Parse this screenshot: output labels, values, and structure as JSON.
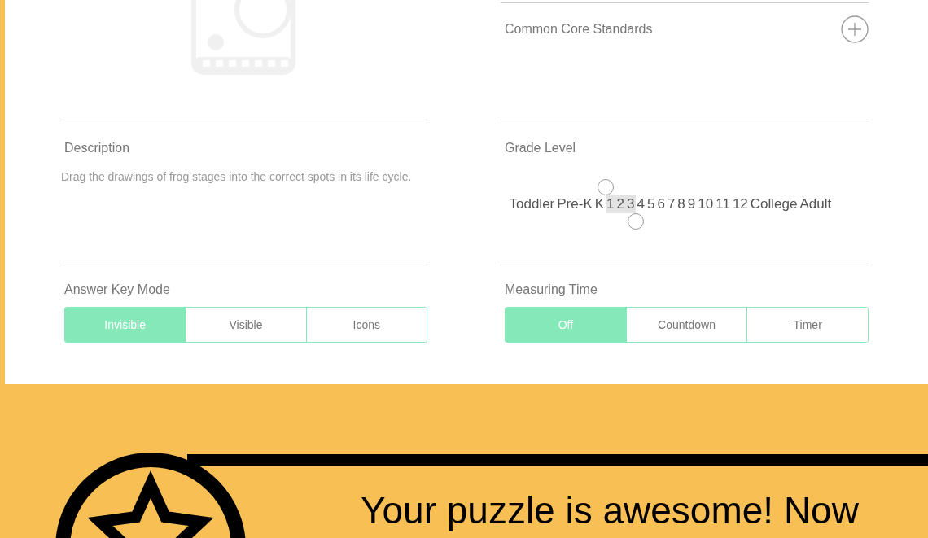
{
  "common_core_standards": {
    "label": "Common Core Standards"
  },
  "description": {
    "label": "Description",
    "text": "Drag the drawings of frog stages into the correct spots in its life cycle."
  },
  "grade_level": {
    "label": "Grade Level",
    "grades": [
      {
        "label": "Toddler",
        "selected": false
      },
      {
        "label": "Pre-K",
        "selected": false
      },
      {
        "label": "K",
        "selected": false
      },
      {
        "label": "1",
        "selected": true
      },
      {
        "label": "2",
        "selected": true
      },
      {
        "label": "3",
        "selected": true
      },
      {
        "label": "4",
        "selected": false
      },
      {
        "label": "5",
        "selected": false
      },
      {
        "label": "6",
        "selected": false
      },
      {
        "label": "7",
        "selected": false
      },
      {
        "label": "8",
        "selected": false
      },
      {
        "label": "9",
        "selected": false
      },
      {
        "label": "10",
        "selected": false
      },
      {
        "label": "11",
        "selected": false
      },
      {
        "label": "12",
        "selected": false
      },
      {
        "label": "College",
        "selected": false
      },
      {
        "label": "Adult",
        "selected": false
      }
    ]
  },
  "answer_key_mode": {
    "label": "Answer Key Mode",
    "options": [
      {
        "label": "Invisible",
        "selected": true
      },
      {
        "label": "Visible",
        "selected": false
      },
      {
        "label": "Icons",
        "selected": false
      }
    ]
  },
  "measuring_time": {
    "label": "Measuring Time",
    "options": [
      {
        "label": "Off",
        "selected": true
      },
      {
        "label": "Countdown",
        "selected": false
      },
      {
        "label": "Timer",
        "selected": false
      }
    ]
  },
  "banner": {
    "text": "Your puzzle is awesome! Now"
  }
}
